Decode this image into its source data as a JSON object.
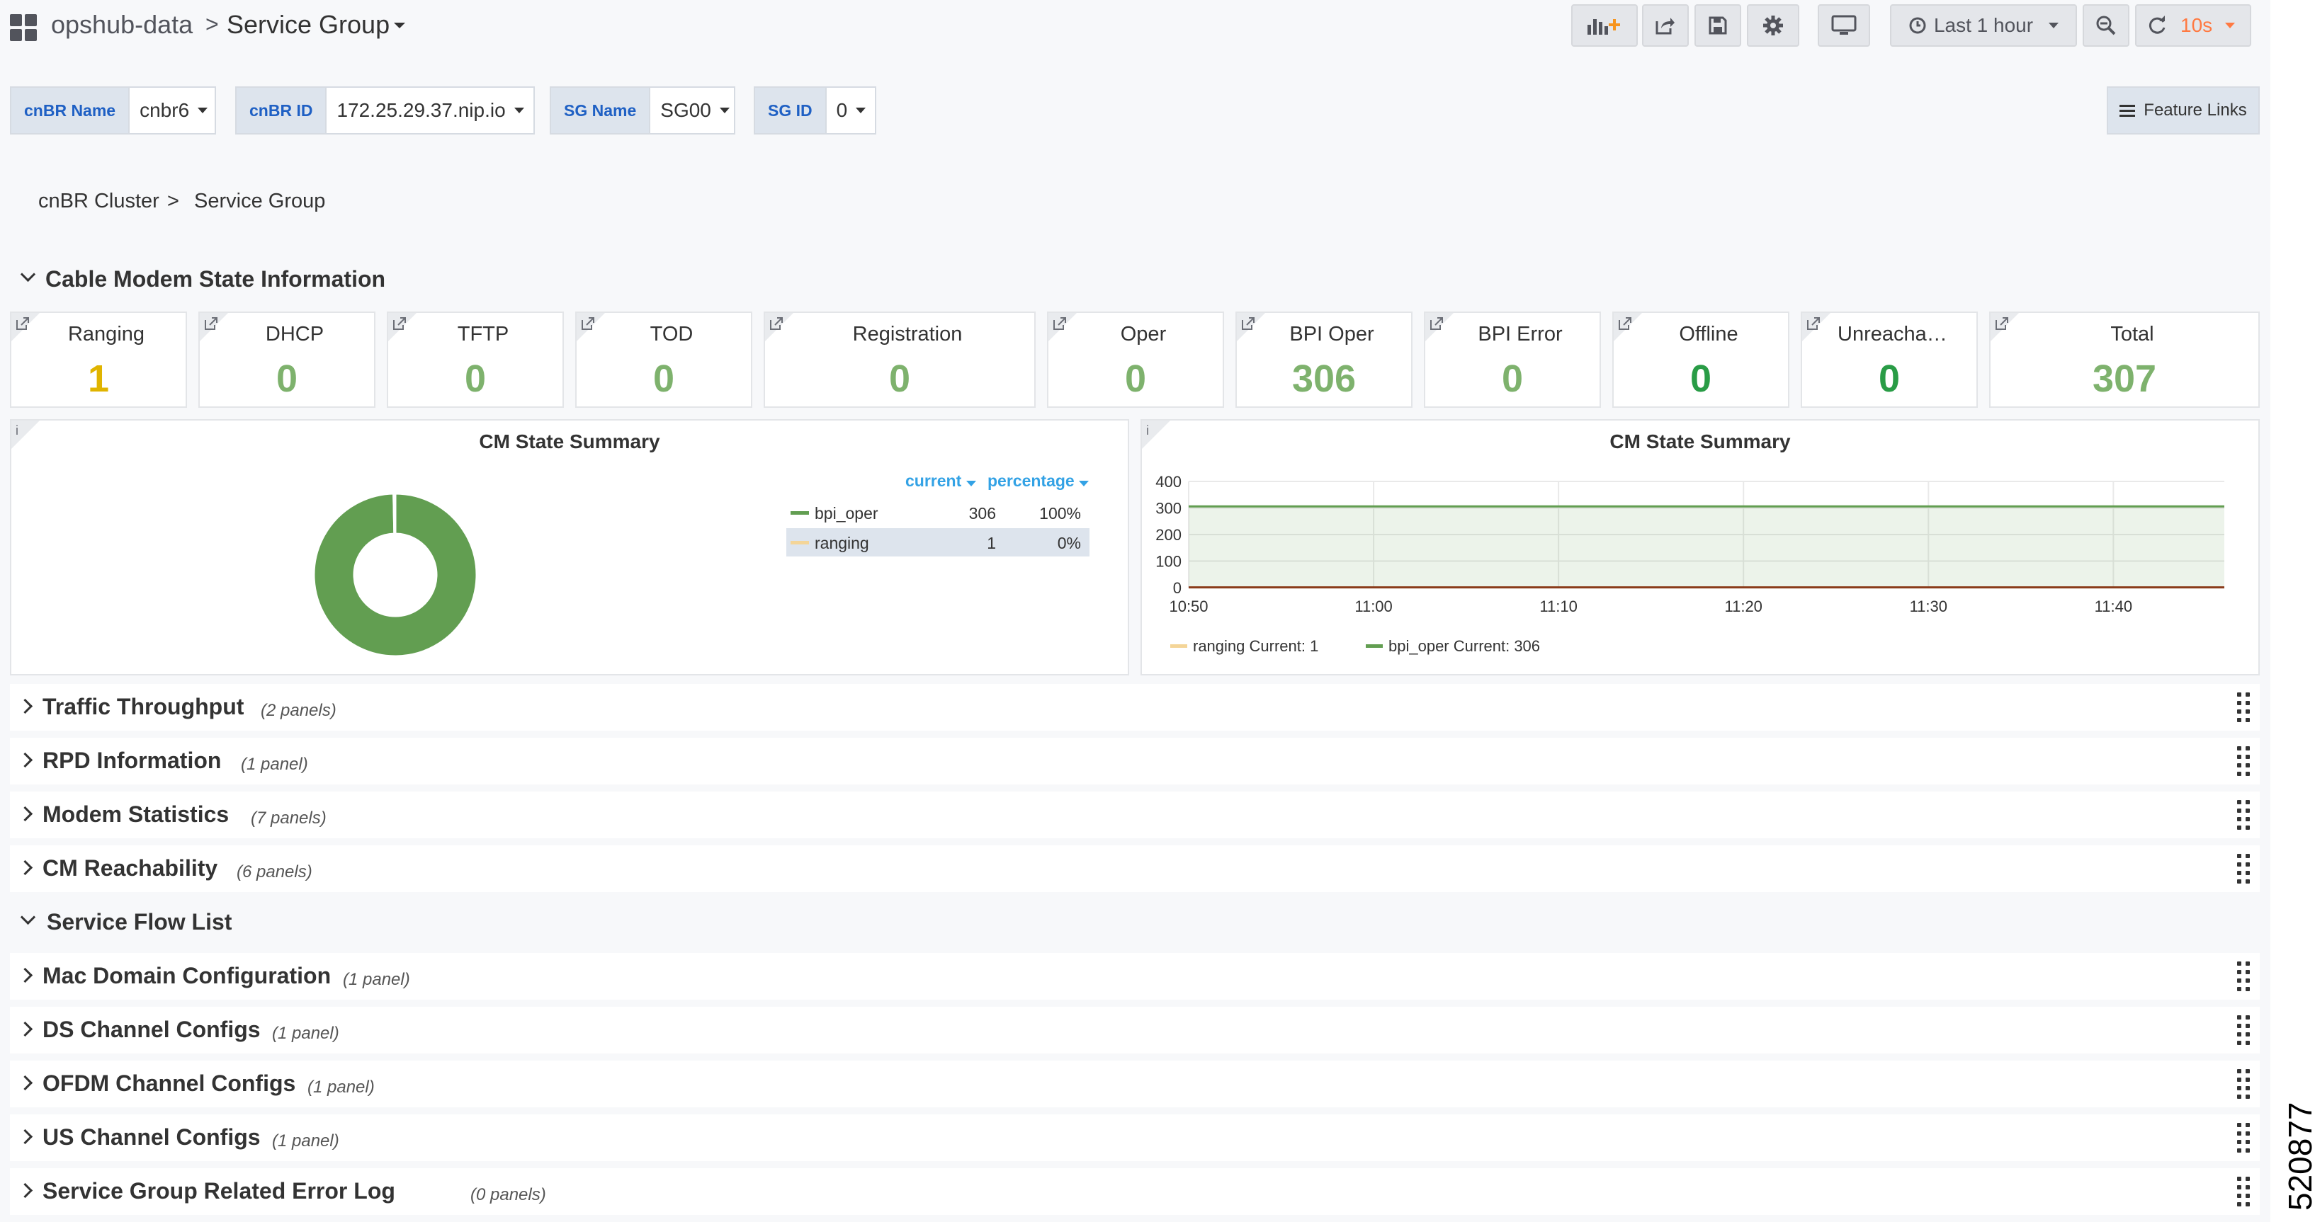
{
  "topbar": {
    "crumb_parent": "opshub-data",
    "crumb_sep": ">",
    "dashboard_title": "Service Group",
    "time_range": "Last 1 hour",
    "refresh_interval": "10s",
    "refresh_color": "#ff7941"
  },
  "variables": [
    {
      "label": "cnBR Name",
      "value": "cnbr6"
    },
    {
      "label": "cnBR ID",
      "value": "172.25.29.37.nip.io"
    },
    {
      "label": "SG Name",
      "value": "SG00"
    },
    {
      "label": "SG ID",
      "value": "0"
    }
  ],
  "feature_links": "Feature Links",
  "breadcrumb": {
    "parent": "cnBR Cluster",
    "sep": ">",
    "current": "Service Group"
  },
  "section_cm_state": "Cable Modem State Information",
  "stats": [
    {
      "title": "Ranging",
      "value": "1",
      "color": "#e0b400"
    },
    {
      "title": "DHCP",
      "value": "0",
      "color": "#7eb26d"
    },
    {
      "title": "TFTP",
      "value": "0",
      "color": "#7eb26d"
    },
    {
      "title": "TOD",
      "value": "0",
      "color": "#7eb26d"
    },
    {
      "title": "Registration",
      "value": "0",
      "color": "#7eb26d"
    },
    {
      "title": "Oper",
      "value": "0",
      "color": "#7eb26d"
    },
    {
      "title": "BPI Oper",
      "value": "306",
      "color": "#7eb26d"
    },
    {
      "title": "BPI Error",
      "value": "0",
      "color": "#7eb26d"
    },
    {
      "title": "Offline",
      "value": "0",
      "color": "#299c46"
    },
    {
      "title": "Unreachabl...",
      "value": "0",
      "color": "#299c46"
    },
    {
      "title": "Total",
      "value": "307",
      "color": "#7eb26d"
    }
  ],
  "chart_data": [
    {
      "type": "pie",
      "title": "CM State Summary",
      "donut": true,
      "legend_headers": {
        "current": "current",
        "percentage": "percentage"
      },
      "series": [
        {
          "name": "bpi_oper",
          "value": 306,
          "percentage": "100%",
          "color": "#629e51"
        },
        {
          "name": "ranging",
          "value": 1,
          "percentage": "0%",
          "color": "#f4d598"
        }
      ]
    },
    {
      "type": "area",
      "title": "CM State Summary",
      "y_ticks": [
        "0",
        "100",
        "200",
        "300",
        "400"
      ],
      "ylim": [
        0,
        400
      ],
      "x_ticks": [
        "10:50",
        "11:00",
        "11:10",
        "11:20",
        "11:30",
        "11:40"
      ],
      "xlim": [
        "10:50",
        "11:46"
      ],
      "grid": true,
      "series": [
        {
          "name": "ranging",
          "current_label": "Current: 1",
          "values": [
            1,
            1
          ],
          "color": "#f4d598"
        },
        {
          "name": "bpi_oper",
          "current_label": "Current: 306",
          "values": [
            306,
            306
          ],
          "color": "#629e51"
        }
      ]
    }
  ],
  "rows": [
    {
      "title": "Traffic Throughput",
      "count": "(2 panels)",
      "collapsed": true
    },
    {
      "title": "RPD Information",
      "count": "(1 panel)",
      "collapsed": true
    },
    {
      "title": "Modem Statistics",
      "count": "(7 panels)",
      "collapsed": true
    },
    {
      "title": "CM Reachability",
      "count": "(6 panels)",
      "collapsed": true
    },
    {
      "title": "Service Flow List",
      "count": "",
      "collapsed": false
    },
    {
      "title": "Mac Domain Configuration",
      "count": "(1 panel)",
      "collapsed": true
    },
    {
      "title": "DS Channel Configs",
      "count": "(1 panel)",
      "collapsed": true
    },
    {
      "title": "OFDM Channel Configs",
      "count": "(1 panel)",
      "collapsed": true
    },
    {
      "title": "US Channel Configs",
      "count": "(1 panel)",
      "collapsed": true
    },
    {
      "title": "Service Group Related Error Log",
      "count": "(0 panels)",
      "collapsed": true
    }
  ],
  "figure_id": "520877"
}
